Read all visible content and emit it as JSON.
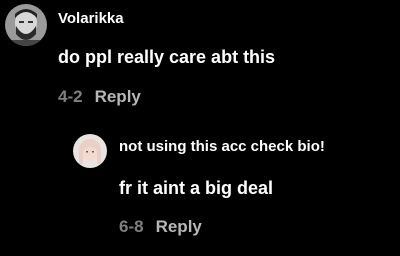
{
  "comments": [
    {
      "username": "Volarikka",
      "text": "do ppl really care abt this",
      "date": "4-2",
      "reply_label": "Reply"
    },
    {
      "username": "not using this acc check bio!",
      "text": "fr it aint a big deal",
      "date": "6-8",
      "reply_label": "Reply"
    }
  ],
  "colors": {
    "background": "#000000",
    "text": "#ffffff",
    "date": "#7f7f7f",
    "reply": "#b7b7b7"
  }
}
